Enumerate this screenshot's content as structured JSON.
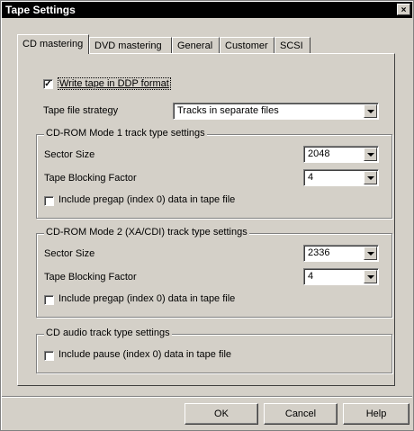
{
  "window": {
    "title": "Tape Settings",
    "close_glyph": "×"
  },
  "tabs": [
    {
      "label": "CD mastering",
      "active": true
    },
    {
      "label": "DVD mastering",
      "active": false
    },
    {
      "label": "General",
      "active": false
    },
    {
      "label": "Customer",
      "active": false
    },
    {
      "label": "SCSI",
      "active": false
    }
  ],
  "ddp": {
    "label": "Write tape in DDP format",
    "checked": true,
    "check_glyph": "✓"
  },
  "tape_file_strategy": {
    "label": "Tape file strategy",
    "value": "Tracks in separate files"
  },
  "mode1": {
    "legend": "CD-ROM Mode 1 track type settings",
    "sector_label": "Sector Size",
    "sector_value": "2048",
    "blocking_label": "Tape Blocking Factor",
    "blocking_value": "4",
    "pregap_label": "Include pregap (index 0) data in tape file",
    "pregap_checked": false
  },
  "mode2": {
    "legend": "CD-ROM Mode 2 (XA/CDI) track type settings",
    "sector_label": "Sector Size",
    "sector_value": "2336",
    "blocking_label": "Tape Blocking Factor",
    "blocking_value": "4",
    "pregap_label": "Include pregap (index 0) data in tape file",
    "pregap_checked": false
  },
  "audio": {
    "legend": "CD audio track type settings",
    "pause_label": "Include pause (index 0) data in tape file",
    "pause_checked": false
  },
  "buttons": {
    "ok": "OK",
    "cancel": "Cancel",
    "help": "Help"
  }
}
